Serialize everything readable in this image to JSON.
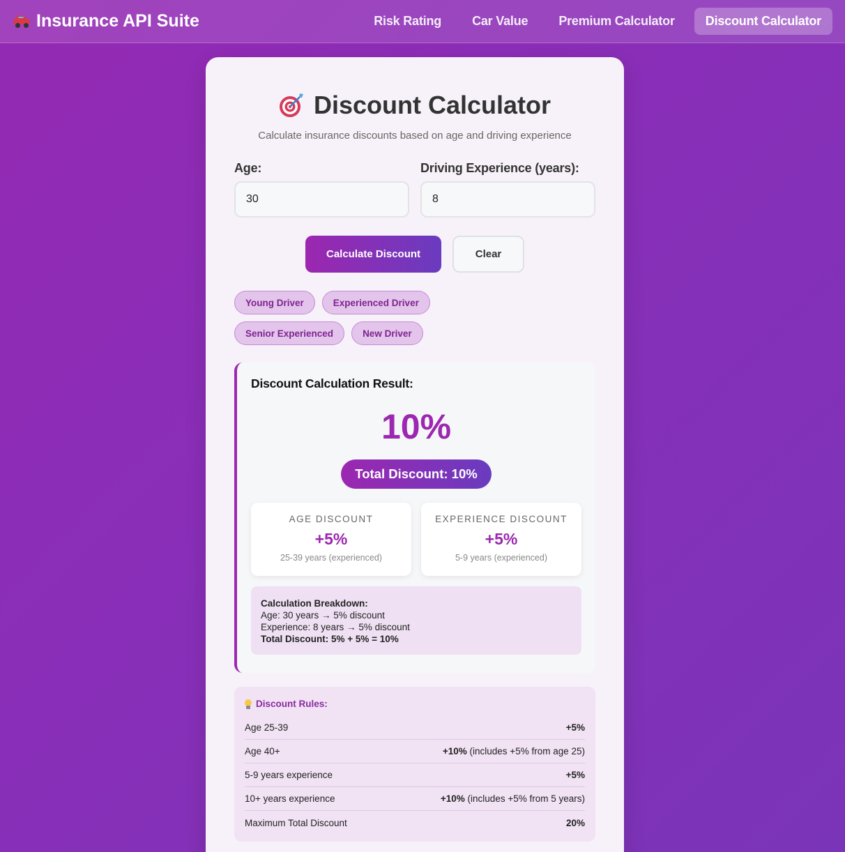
{
  "nav": {
    "brand": "Insurance API Suite",
    "brand_icon": "car-icon",
    "links": [
      "Risk Rating",
      "Car Value",
      "Premium Calculator",
      "Discount Calculator"
    ],
    "active_index": 3
  },
  "header": {
    "title": "Discount Calculator",
    "title_icon": "target-icon",
    "subtitle": "Calculate insurance discounts based on age and driving experience"
  },
  "form": {
    "age_label": "Age:",
    "age_value": "30",
    "experience_label": "Driving Experience (years):",
    "experience_value": "8",
    "calculate_label": "Calculate Discount",
    "clear_label": "Clear"
  },
  "presets": [
    "Young Driver",
    "Experienced Driver",
    "Senior Experienced",
    "New Driver"
  ],
  "result": {
    "heading": "Discount Calculation Result:",
    "big_value": "10%",
    "total_pill": "Total Discount: 10%",
    "age_card": {
      "label": "Age Discount",
      "value": "+5%",
      "note": "25-39 years (experienced)"
    },
    "experience_card": {
      "label": "Experience Discount",
      "value": "+5%",
      "note": "5-9 years (experienced)"
    },
    "breakdown": {
      "title": "Calculation Breakdown:",
      "age_line": "Age: 30 years → 5% discount",
      "experience_line": "Experience: 8 years → 5% discount",
      "total_line": "Total Discount: 5% + 5% = 10%"
    }
  },
  "rules": {
    "heading": "Discount Rules:",
    "heading_icon": "lightbulb-icon",
    "rows": [
      {
        "label": "Age 25-39",
        "value": "+5%",
        "extra": ""
      },
      {
        "label": "Age 40+",
        "value": "+10%",
        "extra": " (includes +5% from age 25)"
      },
      {
        "label": "5-9 years experience",
        "value": "+5%",
        "extra": ""
      },
      {
        "label": "10+ years experience",
        "value": "+10%",
        "extra": " (includes +5% from 5 years)"
      },
      {
        "label": "Maximum Total Discount",
        "value": "20%",
        "extra": ""
      }
    ]
  },
  "colors": {
    "accent": "#9c27b0",
    "accent_end": "#6a3bbf",
    "background": "#8a2eb8"
  }
}
